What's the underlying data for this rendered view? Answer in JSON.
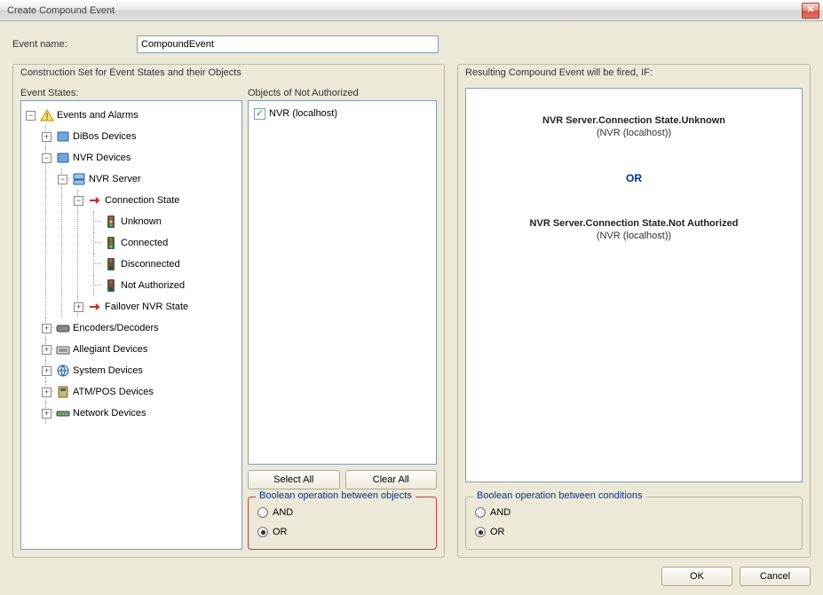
{
  "title": "Create Compound Event",
  "eventNameLabel": "Event name:",
  "eventNameValue": "CompoundEvent",
  "leftPanelTitle": "Construction Set for Event States and their Objects",
  "rightPanelTitle": "Resulting Compound Event will be fired, IF:",
  "eventStatesLabel": "Event States:",
  "objectsLabel": "Objects of Not Authorized",
  "tree": {
    "root": "Events and Alarms",
    "dibos": "DiBos Devices",
    "nvrDev": "NVR Devices",
    "nvrServ": "NVR Server",
    "connState": "Connection State",
    "unknown": "Unknown",
    "connected": "Connected",
    "disconnected": "Disconnected",
    "notAuth": "Not Authorized",
    "failover": "Failover NVR State",
    "encoders": "Encoders/Decoders",
    "allegiant": "Allegiant Devices",
    "system": "System Devices",
    "atm": "ATM/POS Devices",
    "network": "Network Devices"
  },
  "objectItem": "NVR (localhost)",
  "selectAll": "Select All",
  "clearAll": "Clear All",
  "boolObj": {
    "title": "Boolean operation between objects",
    "and": "AND",
    "or": "OR"
  },
  "boolCond": {
    "title": "Boolean operation between conditions",
    "and": "AND",
    "or": "OR"
  },
  "cond1": {
    "title": "NVR Server.Connection State.Unknown",
    "sub": "(NVR (localhost))"
  },
  "cond2": {
    "title": "NVR Server.Connection State.Not Authorized",
    "sub": "(NVR (localhost))"
  },
  "orSep": "OR",
  "ok": "OK",
  "cancel": "Cancel"
}
